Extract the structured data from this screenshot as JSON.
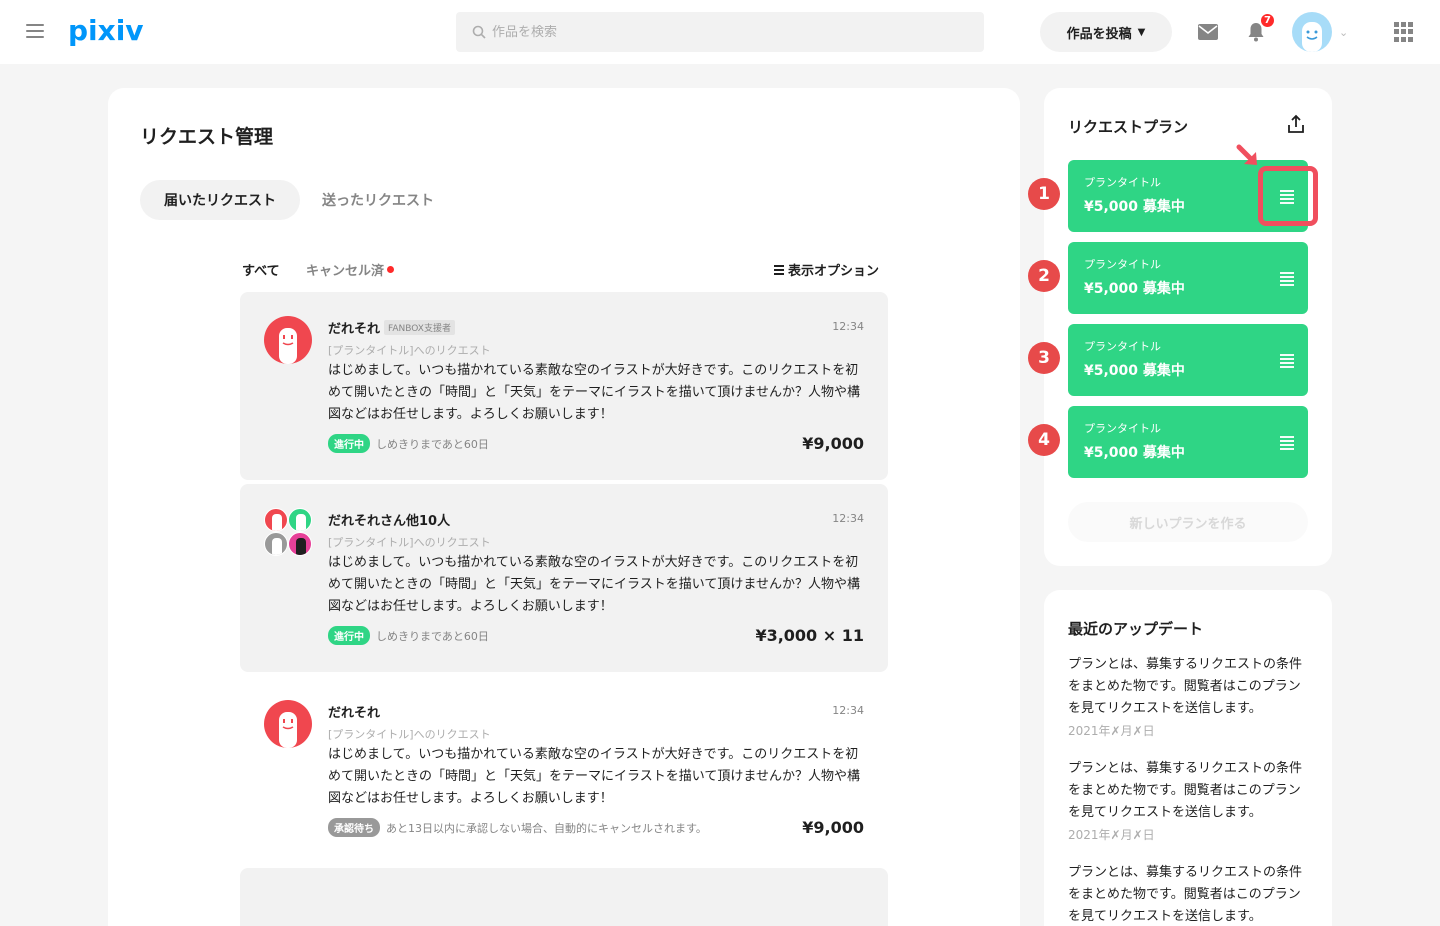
{
  "header": {
    "logo": "pixiv",
    "search_placeholder": "作品を検索",
    "post_label": "作品を投稿",
    "notification_count": "7"
  },
  "main": {
    "title": "リクエスト管理",
    "tabs": [
      {
        "label": "届いたリクエスト"
      },
      {
        "label": "送ったリクエスト"
      }
    ],
    "filters": {
      "all": "すべて",
      "cancelled": "キャンセル済",
      "display_option": "表示オプション"
    },
    "requests": [
      {
        "name": "だれそれ",
        "badge": "FANBOX支援者",
        "time": "12:34",
        "subtitle": "[プランタイトル]へのリクエスト",
        "body": "はじめまして。いつも描かれている素敵な空のイラストが大好きです。このリクエストを初めて開いたときの「時間」と「天気」をテーマにイラストを描いて頂けませんか？人物や構図などはお任せします。よろしくお願いします！",
        "status": "進行中",
        "status_note": "しめきりまであと60日",
        "price": "¥9,000"
      },
      {
        "name": "だれそれさん他10人",
        "time": "12:34",
        "subtitle": "[プランタイトル]へのリクエスト",
        "body": "はじめまして。いつも描かれている素敵な空のイラストが大好きです。このリクエストを初めて開いたときの「時間」と「天気」をテーマにイラストを描いて頂けませんか？人物や構図などはお任せします。よろしくお願いします！",
        "status": "進行中",
        "status_note": "しめきりまであと60日",
        "price": "¥3,000 × 11"
      },
      {
        "name": "だれそれ",
        "time": "12:34",
        "subtitle": "[プランタイトル]へのリクエスト",
        "body": "はじめまして。いつも描かれている素敵な空のイラストが大好きです。このリクエストを初めて開いたときの「時間」と「天気」をテーマにイラストを描いて頂けませんか？人物や構図などはお任せします。よろしくお願いします！",
        "status": "承認待ち",
        "status_note": "あと13日以内に承認しない場合、自動的にキャンセルされます。",
        "price": "¥9,000"
      }
    ]
  },
  "plans": {
    "title": "リクエストプラン",
    "items": [
      {
        "num": "1",
        "title": "プランタイトル",
        "price": "¥5,000 募集中"
      },
      {
        "num": "2",
        "title": "プランタイトル",
        "price": "¥5,000 募集中"
      },
      {
        "num": "3",
        "title": "プランタイトル",
        "price": "¥5,000 募集中"
      },
      {
        "num": "4",
        "title": "プランタイトル",
        "price": "¥5,000 募集中"
      }
    ],
    "new_plan_label": "新しいプランを作る"
  },
  "updates": {
    "title": "最近のアップデート",
    "items": [
      {
        "text": "プランとは、募集するリクエストの条件をまとめた物です。閲覧者はこのプランを見てリクエストを送信します。",
        "date": "2021年✗月✗日"
      },
      {
        "text": "プランとは、募集するリクエストの条件をまとめた物です。閲覧者はこのプランを見てリクエストを送信します。",
        "date": "2021年✗月✗日"
      },
      {
        "text": "プランとは、募集するリクエストの条件をまとめた物です。閲覧者はこのプランを見てリクエストを送信します。",
        "date": ""
      }
    ]
  },
  "colors": {
    "accent_blue": "#0096fa",
    "plan_green": "#2fd585",
    "badge_red": "#ff2a2a",
    "annotation_red": "#e74a4a"
  }
}
